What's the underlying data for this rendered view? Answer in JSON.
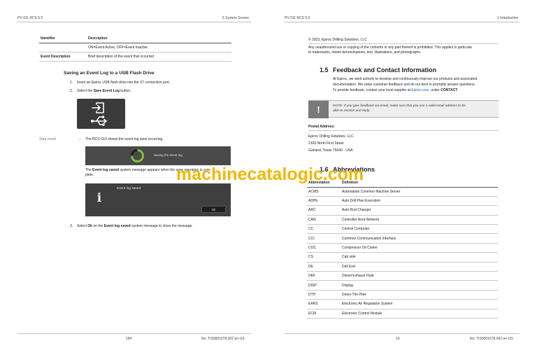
{
  "left_page": {
    "header_left": "PV-311 RCS 5.5",
    "header_right": "6 System Screen",
    "table": {
      "headers": [
        "Identifier",
        "Description"
      ],
      "rows": [
        [
          "",
          "ON=Event Active, OFF=Event Inactive"
        ],
        [
          "Event Description",
          "Brief description of the event that occurred"
        ]
      ]
    },
    "section_title": "Saving an Event Log to a USB Flash Drive",
    "steps": [
      {
        "num": "1.",
        "text": "Insert an Epiroc USB flash drive into the X7 connection port."
      },
      {
        "num": "2.",
        "pre": "Select the ",
        "bold": "Save Event Log",
        "post": " button."
      },
      {
        "num": "3.",
        "pre": "Select ",
        "bold": "Ok",
        "mid": " on the ",
        "bold2": "Event log saved",
        "post": " system message to close the message."
      }
    ],
    "step_result_label": "Step result",
    "result_arrow": "→",
    "result_text": "The RCS GUI shows the event log save occurring.",
    "saving_label": "Saving the event log",
    "event_saved_para": {
      "pre": "The ",
      "bold": "Event log saved",
      "post": " system message appears when the save operation is com-",
      "line2": "plete."
    },
    "dialog_title": "Event log saved",
    "dialog_icon": "i",
    "dialog_ok": "Ok",
    "footer_page": "184",
    "footer_doc": "No: TIS0001678.002 en-US"
  },
  "right_page": {
    "header_left": "PV-311 RCS 5.5",
    "header_right": "1 Introduction",
    "copyright": "© 2023, Epiroc Drilling Solutions, LLC",
    "legal_line1": "Any unauthorized use or copying of the contents or any part thereof is prohibited. This applies in particular",
    "legal_line2": "to trademarks, model denominations, text, illustrations, and photographs.",
    "section_15_num": "1.5",
    "section_15_title": "Feedback and Contact Information",
    "feedback_line1": "At Epiroc, we work actively to develop and continuously improve our products and associated",
    "feedback_line2": "documentation. We value customer feedback and do our best to promptly answer questions.",
    "feedback_line3_pre": "To provide feedback, contact your local supplier at ",
    "feedback_link": "Epiroc.com",
    "feedback_line3_mid": ", under ",
    "feedback_line3_bold": "CONTACT",
    "feedback_line3_end": ".",
    "note_icon": "!",
    "note_line1": "NOTE: If you give feedback via email, make sure that you use a valid email address to be",
    "note_line2": "able to receive and reply.",
    "postal_label": "Postal Address:",
    "address": [
      "Epiroc Drilling Solutions, LLC",
      "2100 North First Street",
      "Garland, Texas 75040 - USA"
    ],
    "section_16_num": "1.6",
    "section_16_title": "Abbreviations",
    "abbr_headers": [
      "Abbreviation",
      "Definition"
    ],
    "abbreviations": [
      [
        "ACMS",
        "Automation Common Machine Server"
      ],
      [
        "ADPE",
        "Auto Drill Plan Execution"
      ],
      [
        "ARC",
        "Auto Rod Changer"
      ],
      [
        "CAN",
        "Controller Area Network"
      ],
      [
        "CC",
        "Central Computer"
      ],
      [
        "CCI",
        "Common Communication Interface"
      ],
      [
        "COC",
        "Compressor Oil Cooler"
      ],
      [
        "CS",
        "Cab side"
      ],
      [
        "DE",
        "Drill End"
      ],
      [
        "DEF",
        "Diesel Exhaust Fluid"
      ],
      [
        "DISP",
        "Display"
      ],
      [
        "DTH",
        "Down-The-Hole"
      ],
      [
        "EARS",
        "Electronic Air Regulation System"
      ],
      [
        "ECM",
        "Electronic Control Module"
      ]
    ],
    "footer_page": "10",
    "footer_doc": "No: TIS0001678.002 en-US"
  },
  "watermark": "machinecatalogic.com",
  "colors": {
    "link": "#1a5fb4",
    "watermark": "#f2b705",
    "gui_dark": "#3b3b3b",
    "spinner_green": "#7ec242"
  },
  "icons": [
    "export-icon",
    "usb-icon",
    "spinner-icon",
    "info-icon",
    "warning-icon",
    "arrow-right-icon"
  ]
}
